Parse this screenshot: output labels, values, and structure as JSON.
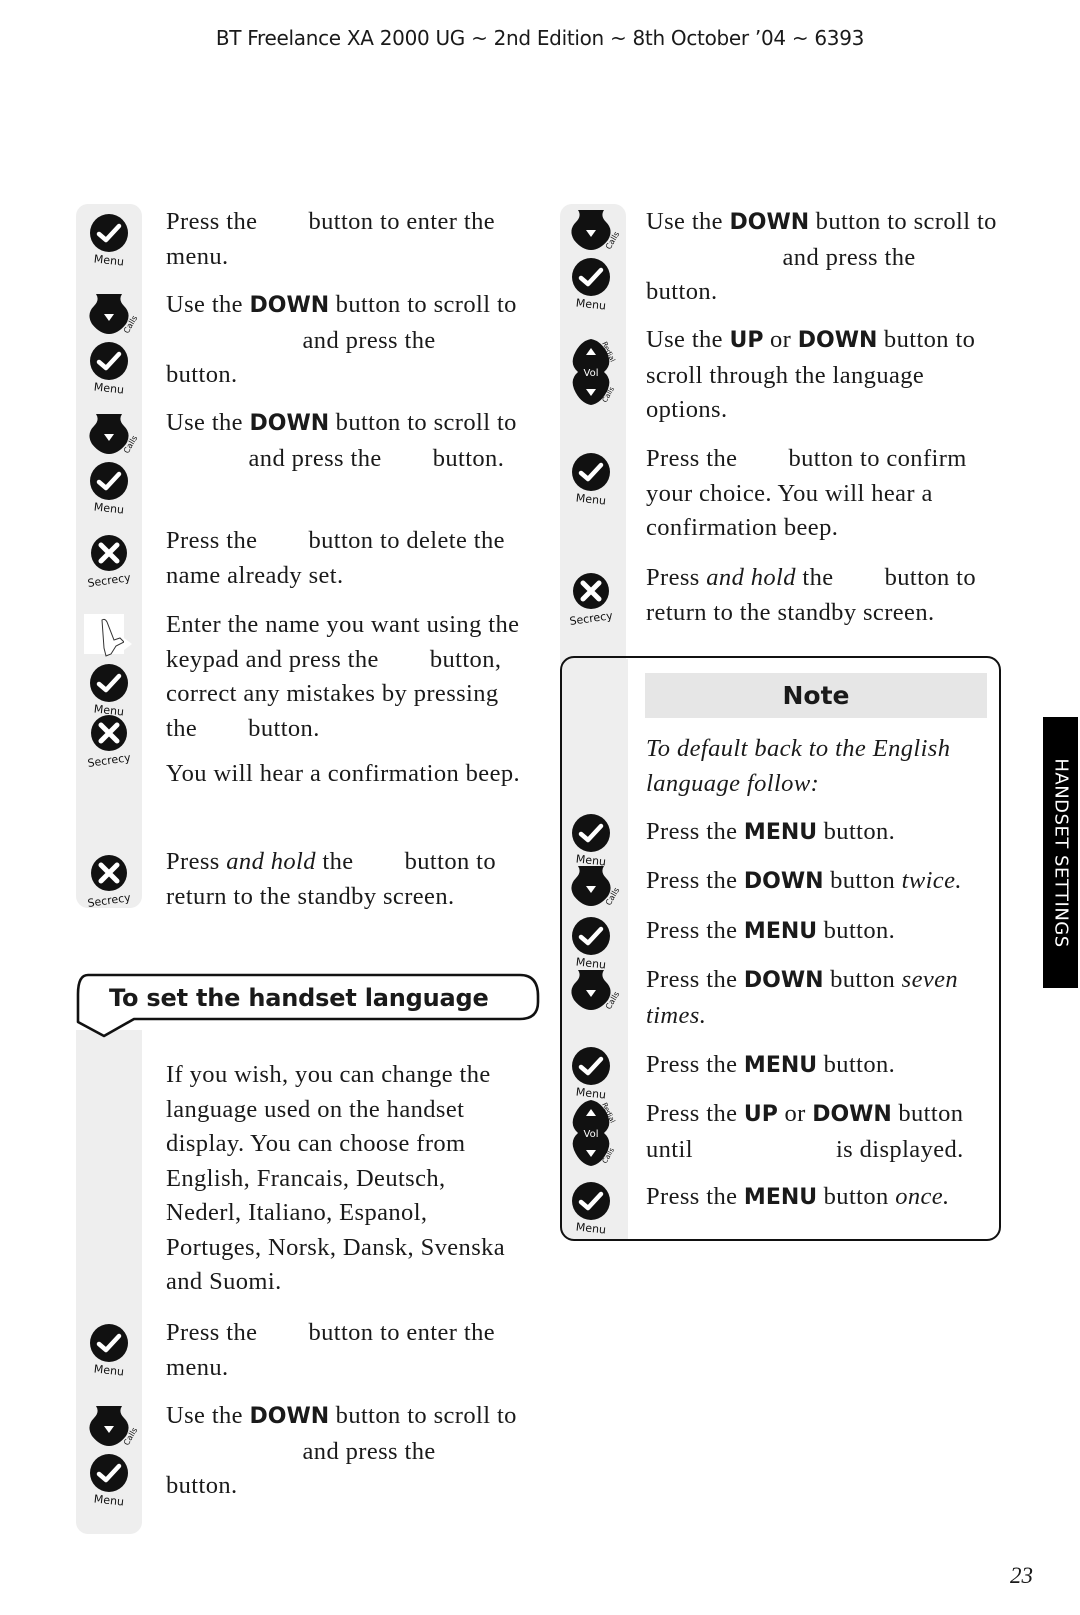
{
  "header": {
    "running_head": "BT Freelance XA 2000 UG ~ 2nd Edition ~ 8th October ’04 ~ 6393"
  },
  "icons": {
    "menu": {
      "name": "menu-check-button",
      "label": "Menu"
    },
    "down": {
      "name": "down-calls-button",
      "label": "Calls"
    },
    "secrecy": {
      "name": "secrecy-x-button",
      "label": "Secrecy"
    },
    "vol": {
      "name": "vol-up-down-button",
      "label": "Vol",
      "sub_up": "Redial",
      "sub_down": "Calls"
    },
    "keypad": {
      "name": "keypad-finger"
    }
  },
  "left_column": {
    "steps": [
      {
        "icons": [
          "menu"
        ],
        "parts": [
          "Press the ",
          "GAP",
          " button to enter the menu."
        ]
      },
      {
        "icons": [
          "down",
          "menu"
        ],
        "parts": [
          "Use the ",
          "B:DOWN",
          " button to scroll to ",
          "GAPL",
          " and press the ",
          "GAP",
          " button."
        ]
      },
      {
        "icons": [
          "down",
          "menu"
        ],
        "parts": [
          "Use the ",
          "B:DOWN",
          " button to scroll to ",
          "GAPM",
          " and press the ",
          "GAP",
          " button."
        ]
      },
      {
        "icons": [
          "secrecy"
        ],
        "parts": [
          "Press the ",
          "GAP",
          " button to delete the name already set."
        ]
      },
      {
        "icons": [
          "keypad",
          "menu",
          "secrecy"
        ],
        "parts": [
          "Enter the name you want using the keypad and press the ",
          "GAP",
          " button, correct any mistakes by pressing the ",
          "GAP",
          " button."
        ]
      },
      {
        "icons": [],
        "parts": [
          "You will hear a confirmation beep."
        ]
      },
      {
        "icons": [
          "secrecy"
        ],
        "parts": [
          "Press ",
          "I:and hold",
          " the ",
          "GAP",
          " button to return to the standby screen."
        ]
      }
    ],
    "section_title": "To set the handset language",
    "intro": "If you wish, you can change the language used on the handset display. You can choose from English, Francais, Deutsch, Nederl, Italiano, Espanol, Portuges, Norsk, Dansk, Svenska and Suomi.",
    "lang_steps": [
      {
        "icons": [
          "menu"
        ],
        "parts": [
          "Press the ",
          "GAP",
          " button to enter the menu."
        ]
      },
      {
        "icons": [
          "down",
          "menu"
        ],
        "parts": [
          "Use the ",
          "B:DOWN",
          " button to scroll to ",
          "GAPL",
          " and press the ",
          "GAP",
          " button."
        ]
      }
    ]
  },
  "right_column": {
    "steps": [
      {
        "icons": [
          "down",
          "menu"
        ],
        "parts": [
          "Use the ",
          "B:DOWN",
          " button to scroll to ",
          "GAPL",
          " and press the ",
          "GAP",
          " button."
        ]
      },
      {
        "icons": [
          "vol"
        ],
        "parts": [
          "Use the ",
          "B:UP",
          " or ",
          "B:DOWN",
          " button to scroll through the language options."
        ]
      },
      {
        "icons": [
          "menu"
        ],
        "parts": [
          "Press the ",
          "GAP",
          " button to confirm your choice. You will hear a confirmation beep."
        ]
      },
      {
        "icons": [
          "secrecy"
        ],
        "parts": [
          "Press ",
          "I:and hold",
          " the ",
          "GAP",
          " button to return to the standby screen."
        ]
      }
    ],
    "note": {
      "title": "Note",
      "intro": "To default back to the English language follow:",
      "steps": [
        {
          "icons": [
            "menu"
          ],
          "parts": [
            "Press the ",
            "B:MENU",
            " button."
          ]
        },
        {
          "icons": [
            "down"
          ],
          "parts": [
            "Press the ",
            "B:DOWN",
            " button ",
            "I:twice."
          ]
        },
        {
          "icons": [
            "menu"
          ],
          "parts": [
            "Press the ",
            "B:MENU",
            " button."
          ]
        },
        {
          "icons": [
            "down"
          ],
          "parts": [
            "Press the ",
            "B:DOWN",
            " button ",
            "I:seven times."
          ]
        },
        {
          "icons": [
            "menu"
          ],
          "parts": [
            "Press the ",
            "B:MENU",
            " button."
          ]
        },
        {
          "icons": [
            "vol"
          ],
          "parts": [
            "Press the ",
            "B:UP",
            " or ",
            "B:DOWN",
            " button until ",
            "GAPL",
            " is displayed."
          ]
        },
        {
          "icons": [
            "menu"
          ],
          "parts": [
            "Press the ",
            "B:MENU",
            " button ",
            "I:once."
          ]
        }
      ]
    }
  },
  "side_tab": {
    "label": "HANDSET SETTINGS"
  },
  "footer": {
    "page_number": "23"
  }
}
